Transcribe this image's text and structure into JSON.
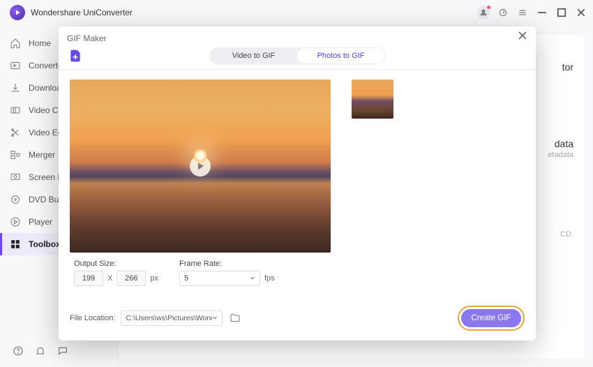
{
  "app": {
    "title": "Wondershare UniConverter"
  },
  "sidebar": {
    "items": [
      {
        "label": "Home"
      },
      {
        "label": "Converter"
      },
      {
        "label": "Downloader"
      },
      {
        "label": "Video Compressor"
      },
      {
        "label": "Video Editor"
      },
      {
        "label": "Merger"
      },
      {
        "label": "Screen Recorder"
      },
      {
        "label": "DVD Burner"
      },
      {
        "label": "Player"
      },
      {
        "label": "Toolbox"
      }
    ]
  },
  "background": {
    "right1": "tor",
    "right2": "data",
    "right3": "etadata",
    "right4": "CD."
  },
  "dialog": {
    "title": "GIF Maker",
    "tabs": {
      "video": "Video to GIF",
      "photos": "Photos to GIF"
    },
    "output_size_label": "Output Size:",
    "frame_rate_label": "Frame Rate:",
    "width": "199",
    "height": "266",
    "px": "px",
    "x": "X",
    "frame_rate": "5",
    "fps": "fps",
    "file_location_label": "File Location:",
    "file_location": "C:\\Users\\ws\\Pictures\\Wonders",
    "create_btn": "Create GIF"
  }
}
